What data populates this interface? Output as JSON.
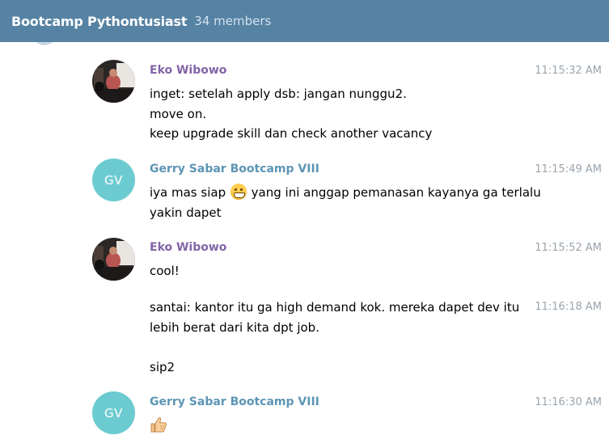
{
  "header": {
    "title": "Bootcamp Pythontusiast",
    "members": "34 members"
  },
  "messages": [
    {
      "author": "Eko Wibowo",
      "time": "11:15:32 AM",
      "lines": [
        "inget: setelah apply dsb: jangan nunggu2.",
        "move on.",
        "keep upgrade skill dan check another vacancy"
      ]
    },
    {
      "author": "Gerry Sabar Bootcamp VIII",
      "avatar_initials": "GV",
      "time": "11:15:49 AM",
      "line1_before": "iya mas siap",
      "emoji": "grinning-face",
      "line1_after": "yang ini anggap pemanasan kayanya ga terlalu",
      "line2": "yakin dapet"
    },
    {
      "author": "Eko Wibowo",
      "time": "11:15:52 AM",
      "text": "cool!"
    },
    {
      "time": "11:16:18 AM",
      "lines": [
        "santai: kantor itu ga high demand kok. mereka dapet dev itu",
        "lebih berat dari kita dpt job.",
        "",
        "sip2"
      ]
    },
    {
      "author": "Gerry Sabar Bootcamp VIII",
      "avatar_initials": "GV",
      "time": "11:16:30 AM",
      "emoji": "thumbs-up"
    }
  ],
  "colors": {
    "header_bg": "#5682a3",
    "eko_name": "#8364a8",
    "gerry_name": "#5d95b5",
    "gv_avatar": "#6ccbd0",
    "timestamp": "#9aa4ad"
  }
}
